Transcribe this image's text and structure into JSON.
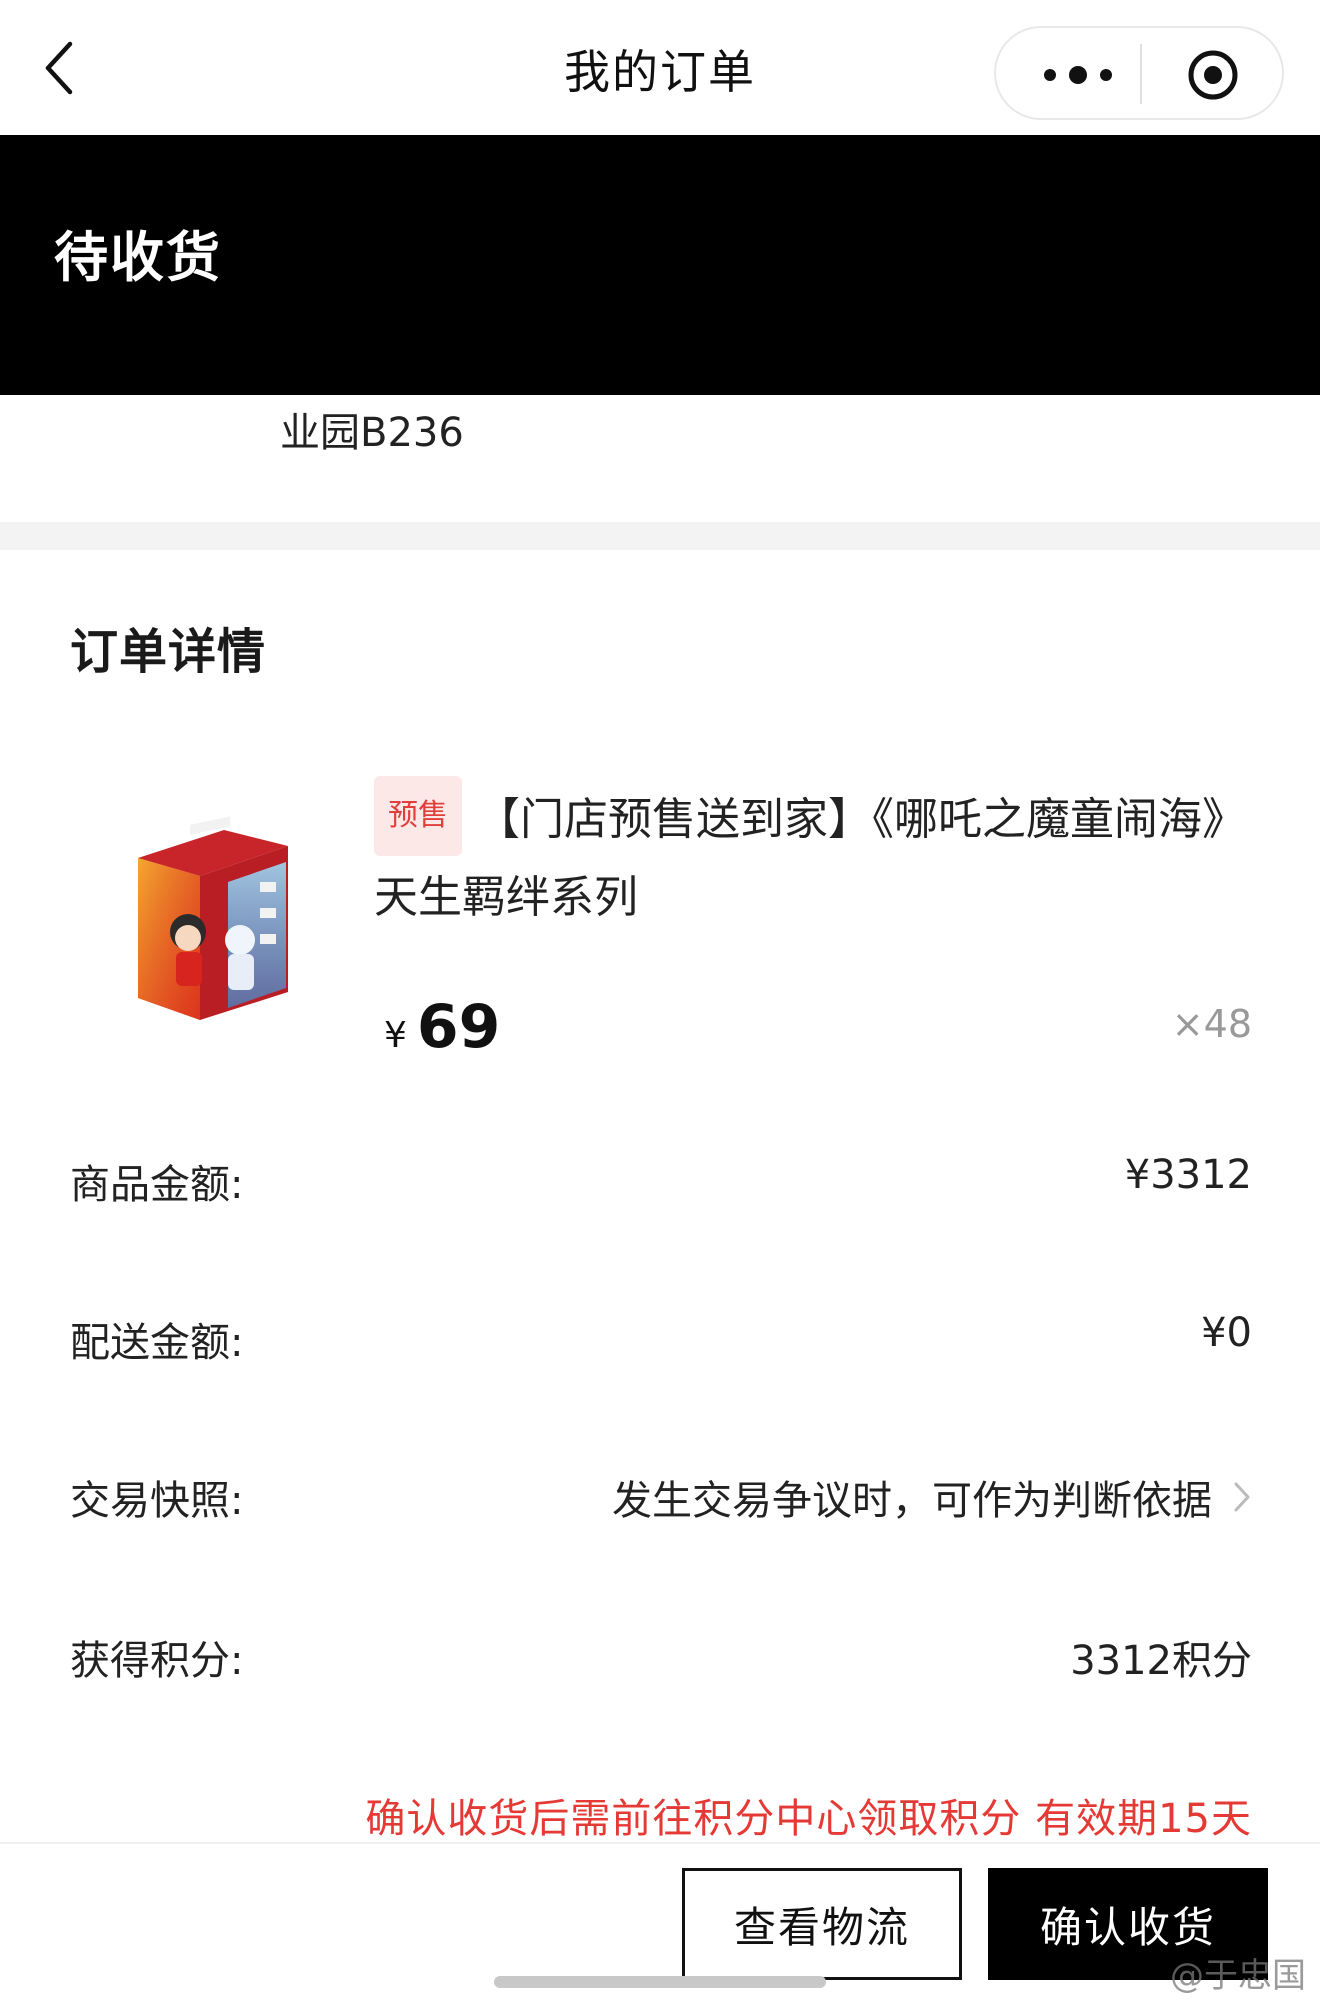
{
  "nav": {
    "title": "我的订单"
  },
  "status": {
    "label": "待收货"
  },
  "address": {
    "fragment": "业园B236"
  },
  "order": {
    "section_title": "订单详情",
    "product": {
      "tag": "预售",
      "title": "【门店预售送到家】《哪吒之魔童闹海》天生羁绊系列",
      "currency": "¥",
      "price": "69",
      "quantity": "×48"
    },
    "rows": [
      {
        "label": "商品金额:",
        "value": "¥3312"
      },
      {
        "label": "配送金额:",
        "value": "¥0"
      },
      {
        "label": "交易快照:",
        "value": "发生交易争议时，可作为判断依据"
      },
      {
        "label": "获得积分:",
        "value": "3312积分"
      }
    ],
    "notice": "确认收货后需前往积分中心领取积分 有效期15天"
  },
  "actions": {
    "logistics": "查看物流",
    "confirm": "确认收货"
  },
  "watermark": "@于忠国",
  "colors": {
    "banner": "#000000",
    "notice": "#e53935",
    "tag_bg": "#fde8e8",
    "tag_text": "#e0403c"
  }
}
